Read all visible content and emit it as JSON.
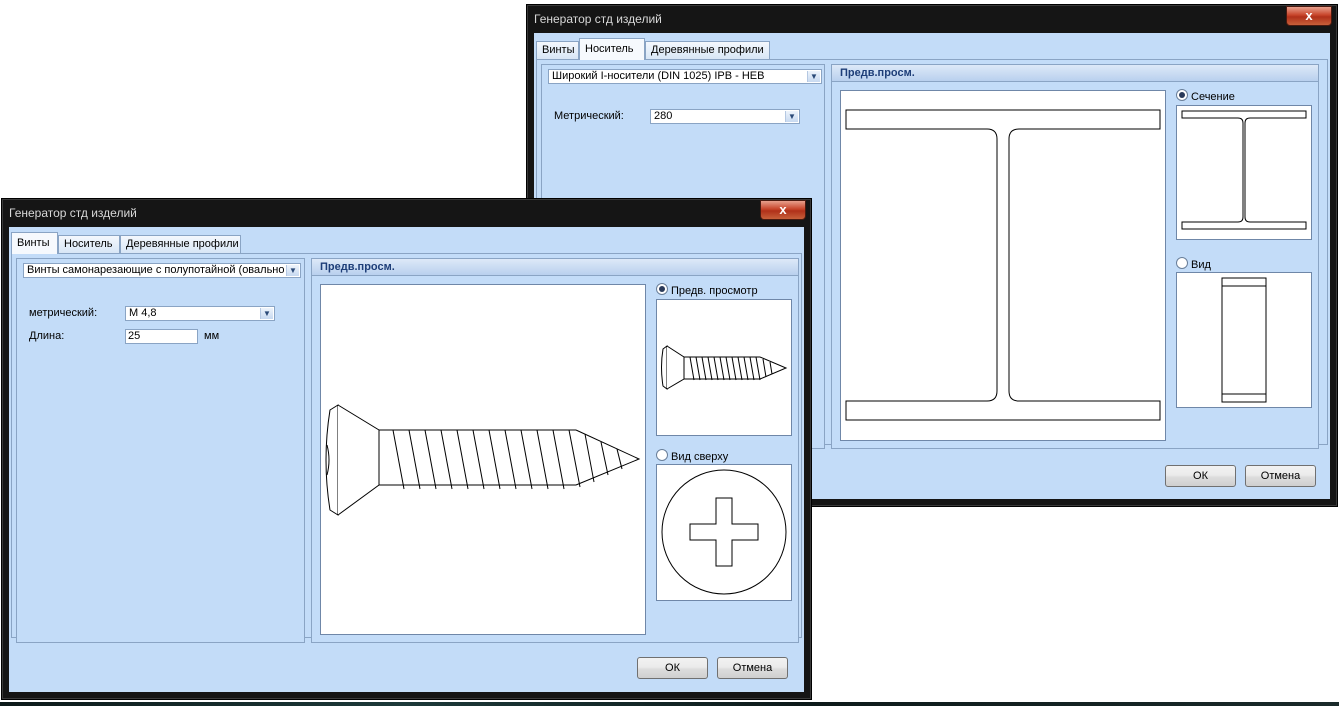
{
  "window_back": {
    "title": "Генератор стд изделий",
    "close_glyph": "x",
    "tabs": [
      {
        "label": "Винты",
        "active": false
      },
      {
        "label": "Носитель",
        "active": true
      },
      {
        "label": "Деревянные профили",
        "active": false
      }
    ],
    "profile_select": "Широкий I-носители (DIN 1025) IPB - HEB",
    "metric_label": "Метрический:",
    "metric_value": "280",
    "preview_title": "Предв.просм.",
    "radio_section": "Сечение",
    "radio_section_checked": true,
    "radio_view": "Вид",
    "radio_view_checked": false,
    "ok_label": "ОК",
    "cancel_label": "Отмена"
  },
  "window_front": {
    "title": "Генератор стд изделий",
    "close_glyph": "x",
    "tabs": [
      {
        "label": "Винты",
        "active": true
      },
      {
        "label": "Носитель",
        "active": false
      },
      {
        "label": "Деревянные профили",
        "active": false
      }
    ],
    "screw_type_select": "Винты самонарезающие с полупотайной (овальной) головкой",
    "metric_label": "метрический:",
    "metric_value": "М 4,8",
    "length_label": "Длина:",
    "length_value": "25",
    "length_unit": "мм",
    "preview_title": "Предв.просм.",
    "radio_preview": "Предв. просмотр",
    "radio_preview_checked": true,
    "radio_top": "Вид сверху",
    "radio_top_checked": false,
    "ok_label": "ОК",
    "cancel_label": "Отмена"
  },
  "icons": {
    "dropdown": "chevron-down-icon",
    "close": "close-icon"
  }
}
